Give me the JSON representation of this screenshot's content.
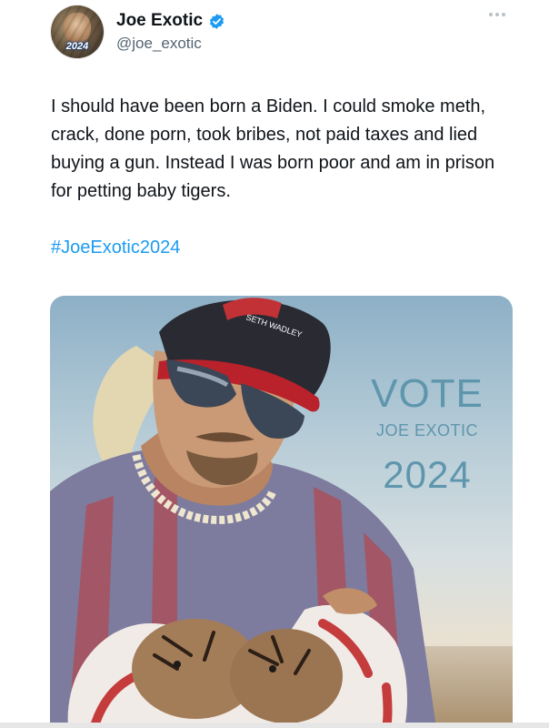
{
  "author": {
    "display_name": "Joe Exotic",
    "handle": "@joe_exotic",
    "avatar_badge_text": "2024",
    "verified": true
  },
  "tweet": {
    "text": "I should have been born a Biden. I could smoke meth, crack, done porn, took bribes, not paid taxes and lied buying a gun. Instead I was born poor and am in prison for petting baby tigers.",
    "hashtag": "#JoeExotic2024"
  },
  "media": {
    "vote_title": "VOTE",
    "vote_name": "JOE EXOTIC",
    "vote_year": "2024",
    "cap_text": "SETH WADLEY"
  },
  "colors": {
    "link": "#1d9bf0",
    "verified": "#1d9bf0",
    "vote_text": "#5e96ad",
    "muted": "#536471"
  },
  "icons": {
    "verified": "verified-badge-icon",
    "more": "more-options-icon"
  }
}
